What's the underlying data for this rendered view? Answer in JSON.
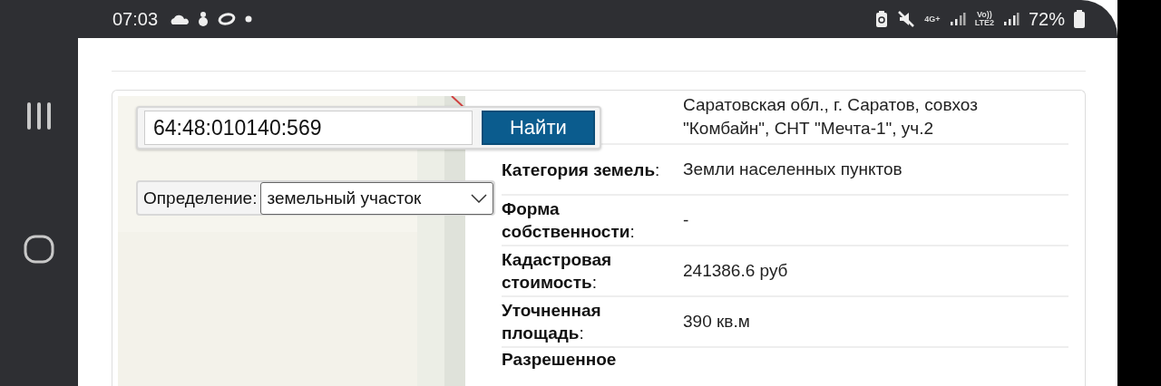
{
  "status_bar": {
    "time": "07:03",
    "network_type": "4G+",
    "volte_top": "Vo))",
    "volte_bottom": "LTE2",
    "battery": "72%"
  },
  "search": {
    "value": "64:48:010140:569",
    "button": "Найти",
    "definition_label": "Определение:",
    "definition_value": "земельный участок"
  },
  "details": [
    {
      "value": "Саратовская обл., г. Саратов, совхоз \"Комбайн\", СНТ \"Мечта-1\", уч.2"
    },
    {
      "label": "**Категория земель**:",
      "value": "Земли населенных пунктов"
    },
    {
      "label": "**Форма собственности**:",
      "value": "-"
    },
    {
      "label": "**Кадастровая стоимость**:",
      "value": "241386.6 руб"
    },
    {
      "label": "**Уточненная площадь**:",
      "value": "390 кв.м"
    },
    {
      "label": "**Разрешенное**"
    }
  ]
}
